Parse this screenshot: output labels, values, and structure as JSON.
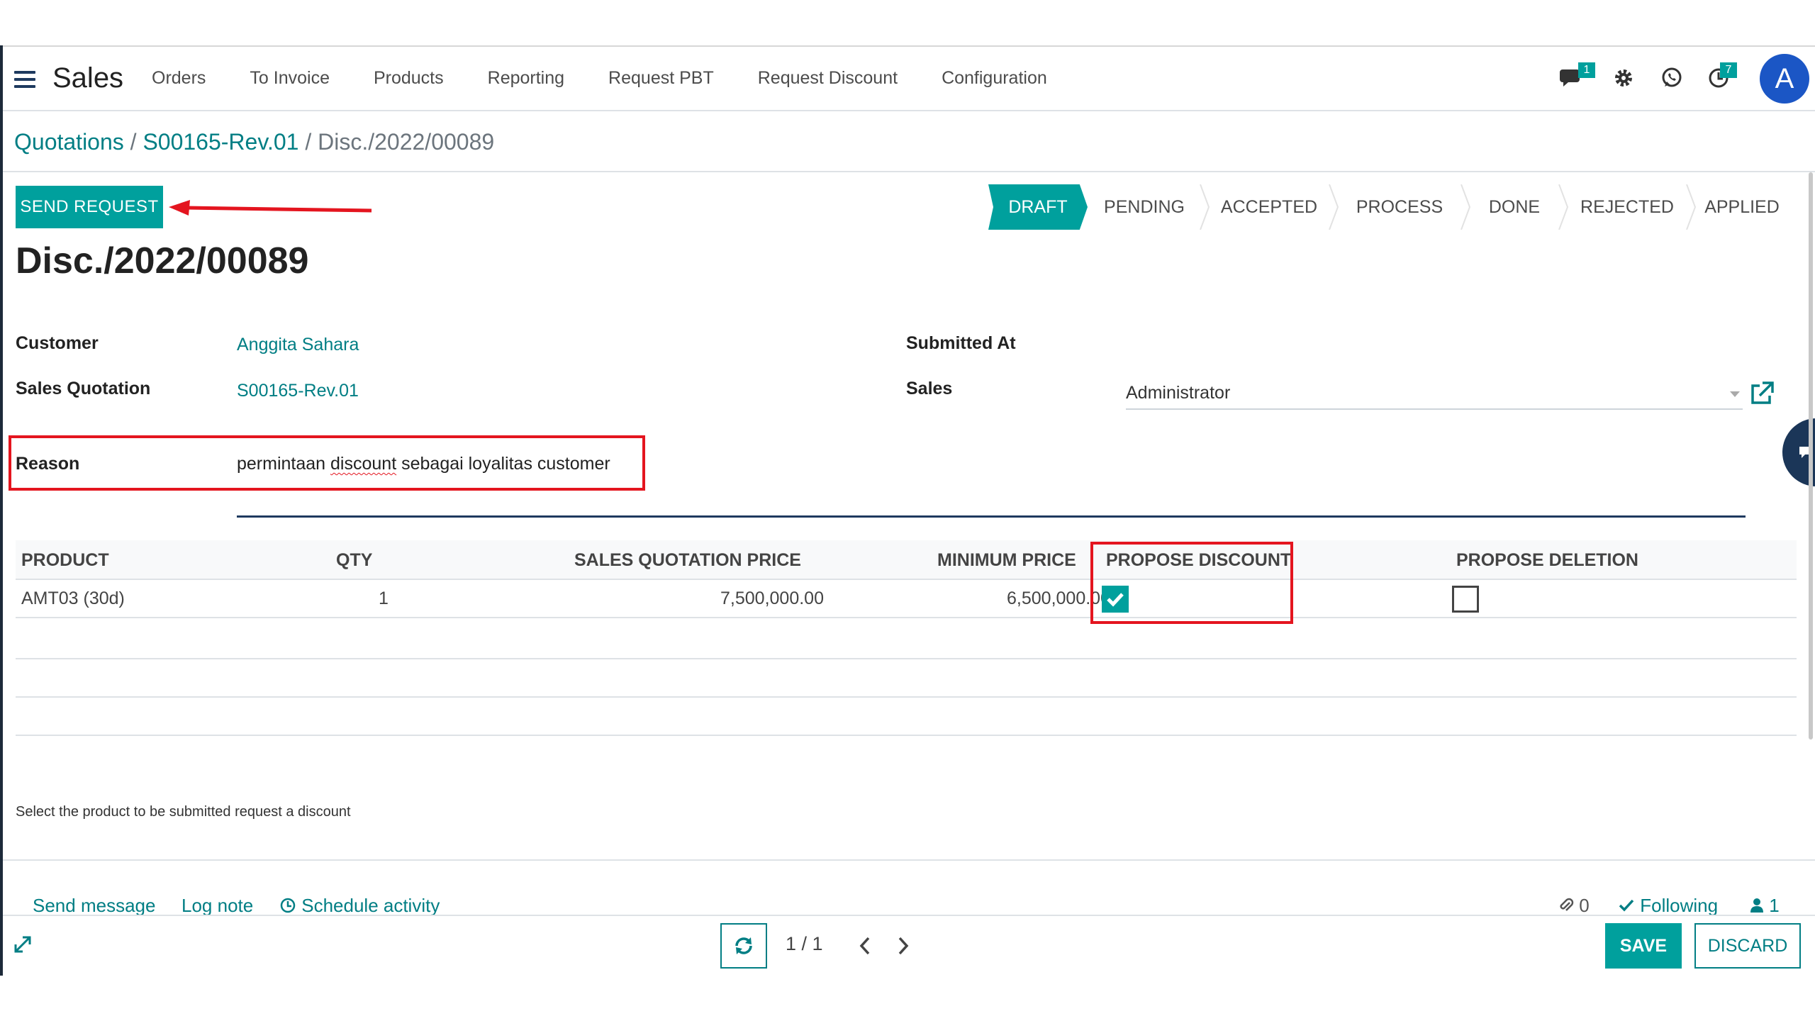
{
  "navbar": {
    "app_name": "Sales",
    "menu": [
      "Orders",
      "To Invoice",
      "Products",
      "Reporting",
      "Request PBT",
      "Request Discount",
      "Configuration"
    ],
    "messages_badge": "1",
    "activities_badge": "7",
    "avatar_letter": "A",
    "icons": [
      "menu-icon",
      "chat-icon",
      "gear-icon",
      "whatsapp-icon",
      "clock-icon"
    ]
  },
  "breadcrumb": {
    "items": [
      "Quotations",
      "S00165-Rev.01"
    ],
    "separator": "/",
    "current": "Disc./2022/00089"
  },
  "actions": {
    "send_request": "SEND REQUEST"
  },
  "status": {
    "stages": [
      "DRAFT",
      "PENDING",
      "ACCEPTED",
      "PROCESS",
      "DONE",
      "REJECTED",
      "APPLIED"
    ],
    "active": "DRAFT"
  },
  "record": {
    "title": "Disc./2022/00089",
    "customer_label": "Customer",
    "customer_value": "Anggita Sahara",
    "quotation_label": "Sales Quotation",
    "quotation_value": "S00165-Rev.01",
    "reason_label": "Reason",
    "reason_before": "permintaan ",
    "reason_misspelled": "discount",
    "reason_after": " sebagai loyalitas customer",
    "submitted_label": "Submitted At",
    "submitted_value": "",
    "sales_label": "Sales",
    "sales_value": "Administrator"
  },
  "table": {
    "headers": [
      "PRODUCT",
      "QTY",
      "SALES QUOTATION PRICE",
      "MINIMUM PRICE",
      "PROPOSE DISCOUNT",
      "PROPOSE DELETION"
    ],
    "rows": [
      {
        "product": "AMT03 (30d)",
        "qty": "1",
        "sales_price": "7,500,000.00",
        "min_price": "6,500,000.00",
        "propose_discount": true,
        "propose_deletion": false
      }
    ]
  },
  "hint": "Select the product to be submitted request a discount",
  "chatter": {
    "send_message": "Send message",
    "log_note": "Log note",
    "schedule_activity": "Schedule activity",
    "attachments": "0",
    "following": "Following",
    "followers": "1"
  },
  "pager": {
    "value": "1 / 1"
  },
  "buttons": {
    "save": "SAVE",
    "discard": "DISCARD"
  },
  "colors": {
    "primary": "#00a09d",
    "link": "#017e84",
    "annotation": "#e4151f",
    "avatar": "#1b56c5"
  }
}
